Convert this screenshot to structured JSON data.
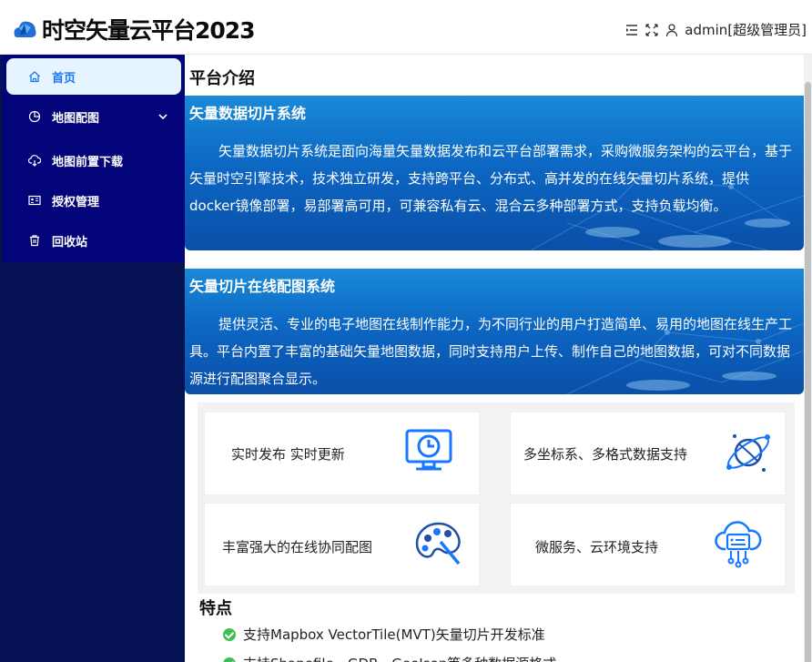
{
  "header": {
    "brand": "时空矢量云平台2023",
    "user": "admin[超级管理员]",
    "icons": [
      "menu-fold-icon",
      "fullscreen-icon",
      "user-icon"
    ]
  },
  "sidebar": {
    "items": [
      {
        "label": "首页",
        "icon": "home-icon",
        "active": true
      },
      {
        "label": "地图配图",
        "icon": "pie-chart-icon",
        "has_submenu": true
      },
      {
        "label": "地图前置下载",
        "icon": "cloud-download-icon"
      },
      {
        "label": "授权管理",
        "icon": "id-card-icon"
      },
      {
        "label": "回收站",
        "icon": "trash-icon"
      }
    ]
  },
  "main": {
    "title": "平台介绍",
    "sections": [
      {
        "title": "矢量数据切片系统",
        "text": "矢量数据切片系统是面向海量矢量数据发布和云平台部署需求，采购微服务架构的云平台，基于矢量时空引擎技术，技术独立研发，支持跨平台、分布式、高并发的在线矢量切片系统，提供docker镜像部署，易部署高可用，可兼容私有云、混合云多种部署方式，支持负载均衡。"
      },
      {
        "title": "矢量切片在线配图系统",
        "text": "提供灵活、专业的电子地图在线制作能力，为不同行业的用户打造简单、易用的地图在线生产工具。平台内置了丰富的基础矢量地图数据，同时支持用户上传、制作自己的地图数据，可对不同数据源进行配图聚合显示。"
      }
    ],
    "cards": [
      {
        "label": "实时发布 实时更新",
        "icon": "monitor-clock-icon"
      },
      {
        "label": "多坐标系、多格式数据支持",
        "icon": "orbit-globe-icon"
      },
      {
        "label": "丰富强大的在线协同配图",
        "icon": "palette-icon"
      },
      {
        "label": "微服务、云环境支持",
        "icon": "cloud-server-icon"
      }
    ],
    "features_title": "特点",
    "features": [
      "支持Mapbox VectorTile(MVT)矢量切片开发标准",
      "支持Shapefile、GDB、GeoJson等多种数据源格式"
    ]
  },
  "colors": {
    "sidebar_bg": "#041254",
    "menu_bg": "#03037a",
    "active_bg": "#e6f4ff",
    "active_text": "#1677ff",
    "banner": "#0c67c3",
    "icon_blue": "#1677ff",
    "check": "#3fbf4f"
  }
}
